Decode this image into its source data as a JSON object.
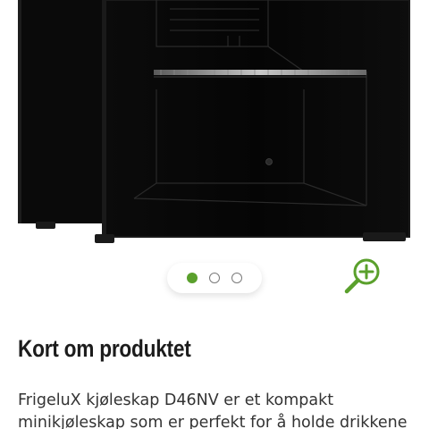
{
  "product": {
    "image_alt": "FrigeluX kjøleskap D46NV",
    "carousel": {
      "total": 3,
      "active_index": 0
    },
    "zoom_icon": "zoom-in-icon",
    "accent_color": "#5aa02c"
  },
  "section": {
    "title": "Kort om produktet",
    "description": "FrigeluX kjøleskap D46NV er et kompakt minikjøleskap som er perfekt for å holde drikkene"
  }
}
